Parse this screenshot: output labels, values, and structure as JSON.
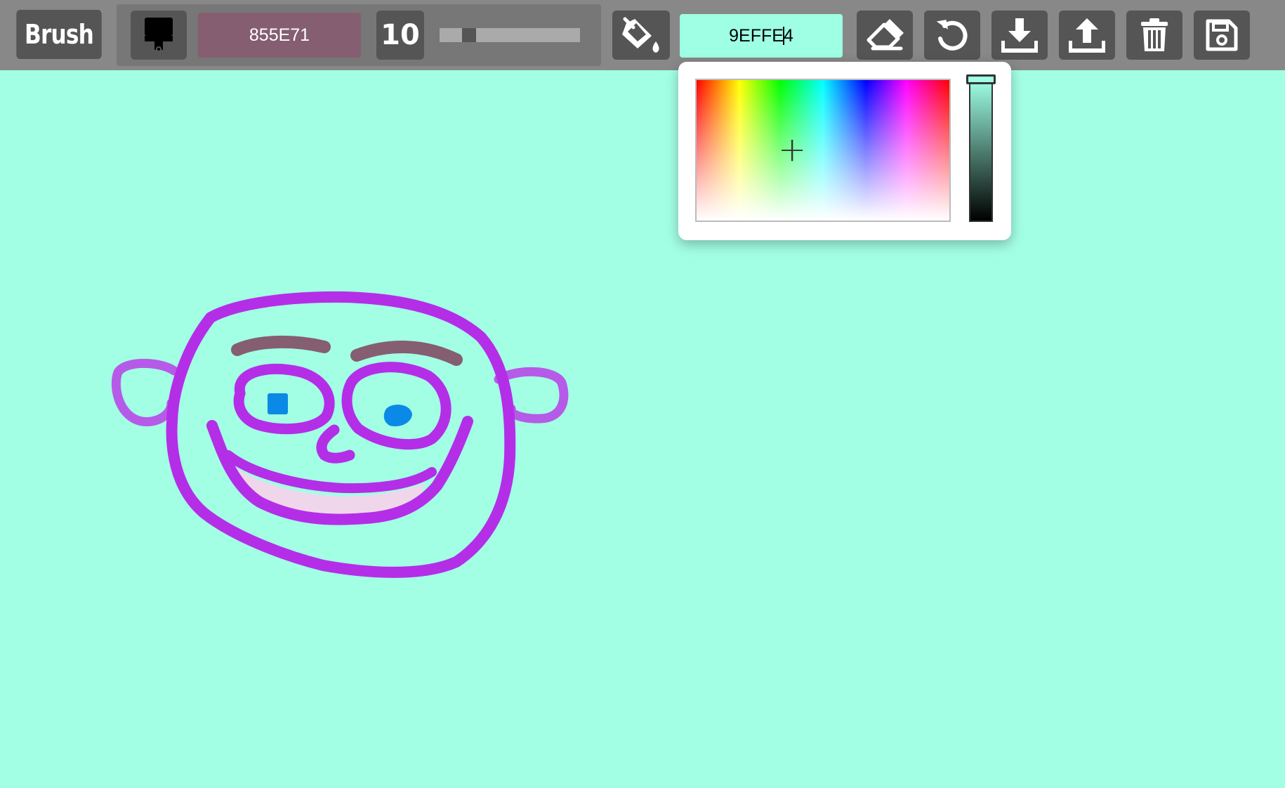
{
  "app": {
    "mode_label": "Brush",
    "brush_color_hex": "855E71",
    "brush_size": "10",
    "brush_size_slider_fraction": 0.18,
    "background_color_hex_before_caret": "9EFFE",
    "background_color_hex_after_caret": "4"
  },
  "toolbar": {
    "icons": [
      "paintbrush-icon",
      "paint-bucket-icon",
      "eraser-icon",
      "undo-icon",
      "download-icon",
      "upload-icon",
      "trash-icon",
      "save-icon"
    ]
  },
  "color_picker": {
    "open": true,
    "crosshair_glyph": "+"
  },
  "colors": {
    "toolbar_bg": "#888888",
    "button_bg": "#555555",
    "canvas_bg": "#a3ffe4",
    "brush_color": "#855e71",
    "drawing_purple": "#b42ee8",
    "eye_blue": "#0a8ae6",
    "mouth_fill": "#f0d6ea"
  }
}
